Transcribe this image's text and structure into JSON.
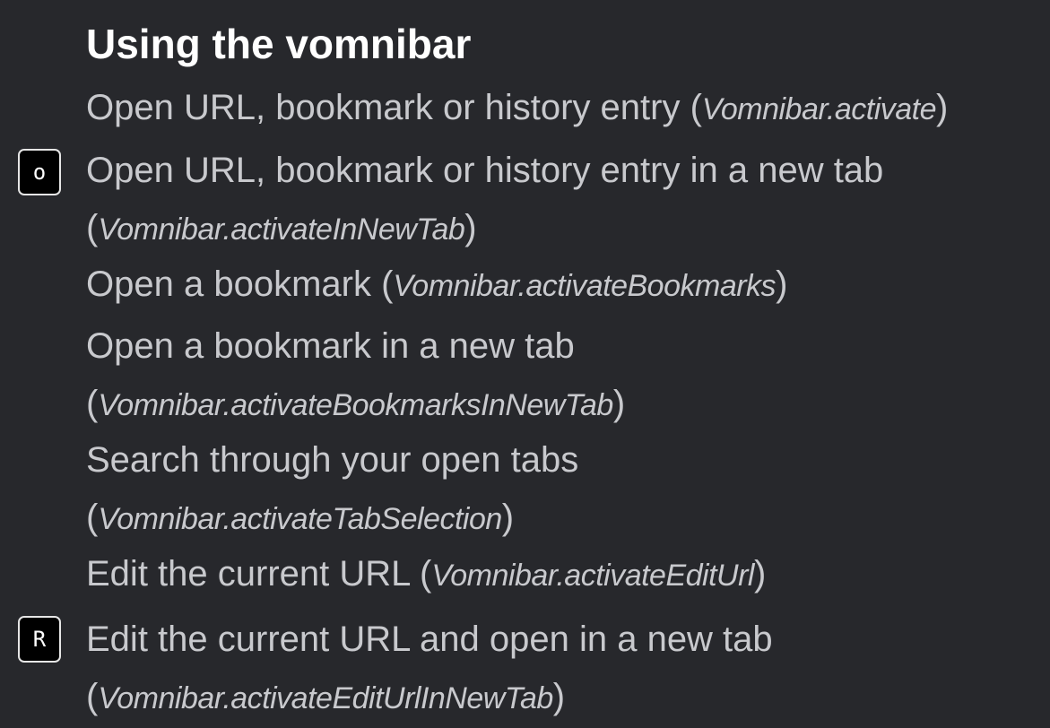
{
  "section": {
    "title": "Using the vomnibar"
  },
  "bindings": [
    {
      "key": "",
      "description": "Open URL, bookmark or history entry",
      "command": "Vomnibar.activate"
    },
    {
      "key": "o",
      "description": "Open URL, bookmark or history entry in a new tab",
      "command": "Vomnibar.activateInNewTab"
    },
    {
      "key": "",
      "description": "Open a bookmark",
      "command": "Vomnibar.activateBookmarks"
    },
    {
      "key": "",
      "description": "Open a bookmark in a new tab",
      "command": "Vomnibar.activateBookmarksInNewTab"
    },
    {
      "key": "",
      "description": "Search through your open tabs",
      "command": "Vomnibar.activateTabSelection"
    },
    {
      "key": "",
      "description": "Edit the current URL",
      "command": "Vomnibar.activateEditUrl"
    },
    {
      "key": "R",
      "description": "Edit the current URL and open in a new tab",
      "command": "Vomnibar.activateEditUrlInNewTab"
    }
  ]
}
